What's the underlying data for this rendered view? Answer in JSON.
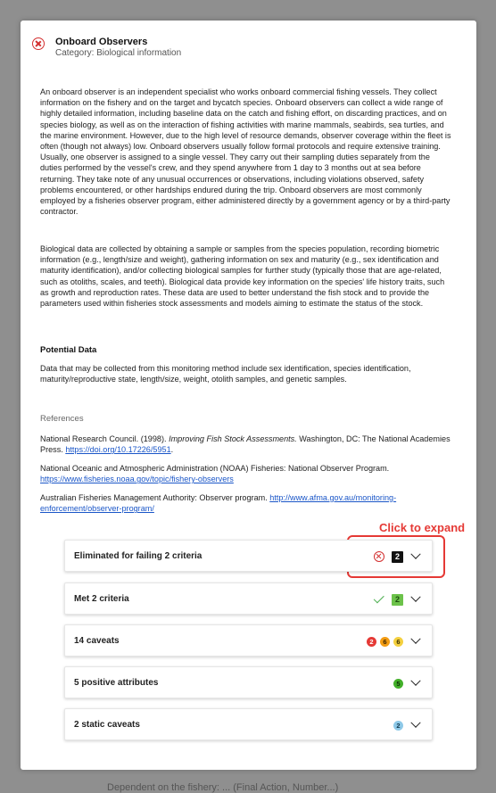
{
  "backdrop": {
    "text": "Dependent on the fishery: ... (Final Action, Number...)"
  },
  "modal": {
    "title": "Onboard Observers",
    "category": "Category: Biological information",
    "paragraphs": [
      "An onboard observer is an independent specialist who works onboard commercial fishing vessels. They collect information on the fishery and on the target and bycatch species. Onboard observers can collect a wide range of highly detailed information, including baseline data on the catch and fishing effort, on discarding practices, and on species biology, as well as on the interaction of fishing activities with marine mammals, seabirds, sea turtles, and the marine environment. However, due to the high level of resource demands, observer coverage within the fleet is often (though not always) low. Onboard observers usually follow formal protocols and require extensive training. Usually, one observer is assigned to a single vessel. They carry out their sampling duties separately from the duties performed by the vessel's crew, and they spend anywhere from 1 day to 3 months out at sea before returning. They take note of any unusual occurrences or observations, including violations observed, safety problems encountered, or other hardships endured during the trip. Onboard observers are most commonly employed by a fisheries observer program, either administered directly by a government agency or by a third-party contractor.",
      "Biological data are collected by obtaining a sample or samples from the species population, recording biometric information (e.g., length/size and weight), gathering information on sex and maturity (e.g., sex identification and maturity identification), and/or collecting biological samples for further study (typically those that are age-related, such as otoliths, scales, and teeth). Biological data provide key information on the species' life history traits, such as growth and reproduction rates. These data are used to better understand the fish stock and to provide the parameters used within fisheries stock assessments and models aiming to estimate the status of the stock."
    ],
    "potential_heading": "Potential Data",
    "potential_text": "Data that may be collected from this monitoring method include sex identification, species identification, maturity/reproductive state, length/size, weight, otolith samples, and genetic samples.",
    "references_heading": "References",
    "references": [
      {
        "pre": "National Research Council. (1998). ",
        "italic": "Improving Fish Stock Assessments.",
        "post": " Washington, DC: The National Academies Press. ",
        "link": "https://doi.org/10.17226/5951",
        "end": "."
      },
      {
        "pre": "National Oceanic and Atmospheric Administration (NOAA) Fisheries: National Observer Program. ",
        "italic": "",
        "post": "",
        "link": "https://www.fisheries.noaa.gov/topic/fishery-observers",
        "end": ""
      },
      {
        "pre": "Australian Fisheries Management Authority: Observer program. ",
        "italic": "",
        "post": "",
        "link": "http://www.afma.gov.au/monitoring-enforcement/observer-program/",
        "end": ""
      }
    ],
    "annotation": "Click to expand",
    "panels": [
      {
        "label": "Eliminated for failing 2 criteria",
        "badges": [
          {
            "kind": "x-circle"
          },
          {
            "kind": "square",
            "value": "2",
            "bg": "#111111",
            "fg": "#ffffff"
          }
        ]
      },
      {
        "label": "Met 2 criteria",
        "badges": [
          {
            "kind": "check"
          },
          {
            "kind": "square",
            "value": "2",
            "bg": "#6cc24a",
            "fg": "#1b4d0e"
          }
        ]
      },
      {
        "label": "14 caveats",
        "badges": [
          {
            "kind": "dot",
            "value": "2",
            "bg": "#e53935",
            "fg": "#ffffff"
          },
          {
            "kind": "dot",
            "value": "6",
            "bg": "#f39c12",
            "fg": "#3a2300"
          },
          {
            "kind": "dot",
            "value": "6",
            "bg": "#f4d03f",
            "fg": "#3a3000"
          }
        ]
      },
      {
        "label": "5 positive attributes",
        "badges": [
          {
            "kind": "dot",
            "value": "5",
            "bg": "#43b02a",
            "fg": "#0d2e06"
          }
        ]
      },
      {
        "label": "2 static caveats",
        "badges": [
          {
            "kind": "dot",
            "value": "2",
            "bg": "#8ec9e8",
            "fg": "#12384d"
          }
        ]
      }
    ]
  }
}
